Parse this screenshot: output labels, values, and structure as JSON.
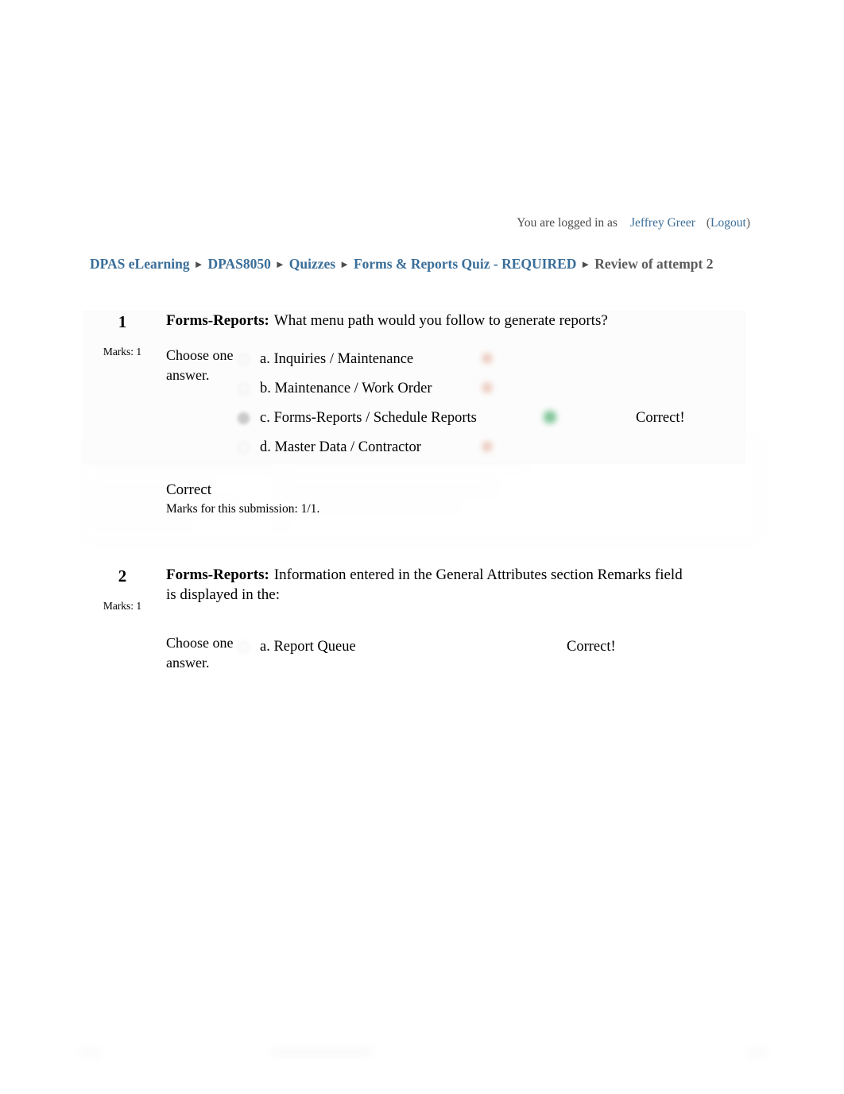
{
  "header": {
    "logged_in_label": "You are logged in as",
    "user_name": "Jeffrey Greer",
    "logout_open": "(",
    "logout_label": "Logout",
    "logout_close": ")"
  },
  "breadcrumb": {
    "separator": "►",
    "items": [
      {
        "label": "DPAS eLearning",
        "is_link": true
      },
      {
        "label": "DPAS8050",
        "is_link": true
      },
      {
        "label": "Quizzes",
        "is_link": true
      },
      {
        "label": "Forms & Reports Quiz - REQUIRED",
        "is_link": true
      },
      {
        "label": "Review of attempt 2",
        "is_link": false
      }
    ]
  },
  "colors": {
    "link": "#3a6e99",
    "breadcrumb_current": "#5a5a5a",
    "correct_mark": "#4fa96e",
    "incorrect_mark": "#d98f78",
    "page_background": "#ffffff",
    "question_card": "#fcfcfc"
  },
  "questions": [
    {
      "number": "1",
      "marks_label": "Marks: 1",
      "tag": "Forms-Reports:",
      "text": "What menu path would you follow to generate reports?",
      "choose_label": "Choose one answer.",
      "options": [
        {
          "label": "a. Inquiries / Maintenance",
          "selected": false,
          "state": "incorrect",
          "feedback": ""
        },
        {
          "label": "b. Maintenance / Work Order",
          "selected": false,
          "state": "incorrect",
          "feedback": ""
        },
        {
          "label": "c. Forms-Reports / Schedule Reports",
          "selected": true,
          "state": "correct",
          "feedback": "Correct!"
        },
        {
          "label": "d. Master Data / Contractor",
          "selected": false,
          "state": "incorrect",
          "feedback": ""
        }
      ],
      "result_title": "Correct",
      "result_marks": "Marks for this submission: 1/1."
    },
    {
      "number": "2",
      "marks_label": "Marks: 1",
      "tag": "Forms-Reports:",
      "text": "Information entered in the General Attributes section Remarks field is displayed in the:",
      "choose_label": "Choose one answer.",
      "options": [
        {
          "label": "a. Report Queue",
          "selected": false,
          "state": "correct",
          "feedback": "Correct!"
        }
      ],
      "result_title": "",
      "result_marks": ""
    }
  ]
}
